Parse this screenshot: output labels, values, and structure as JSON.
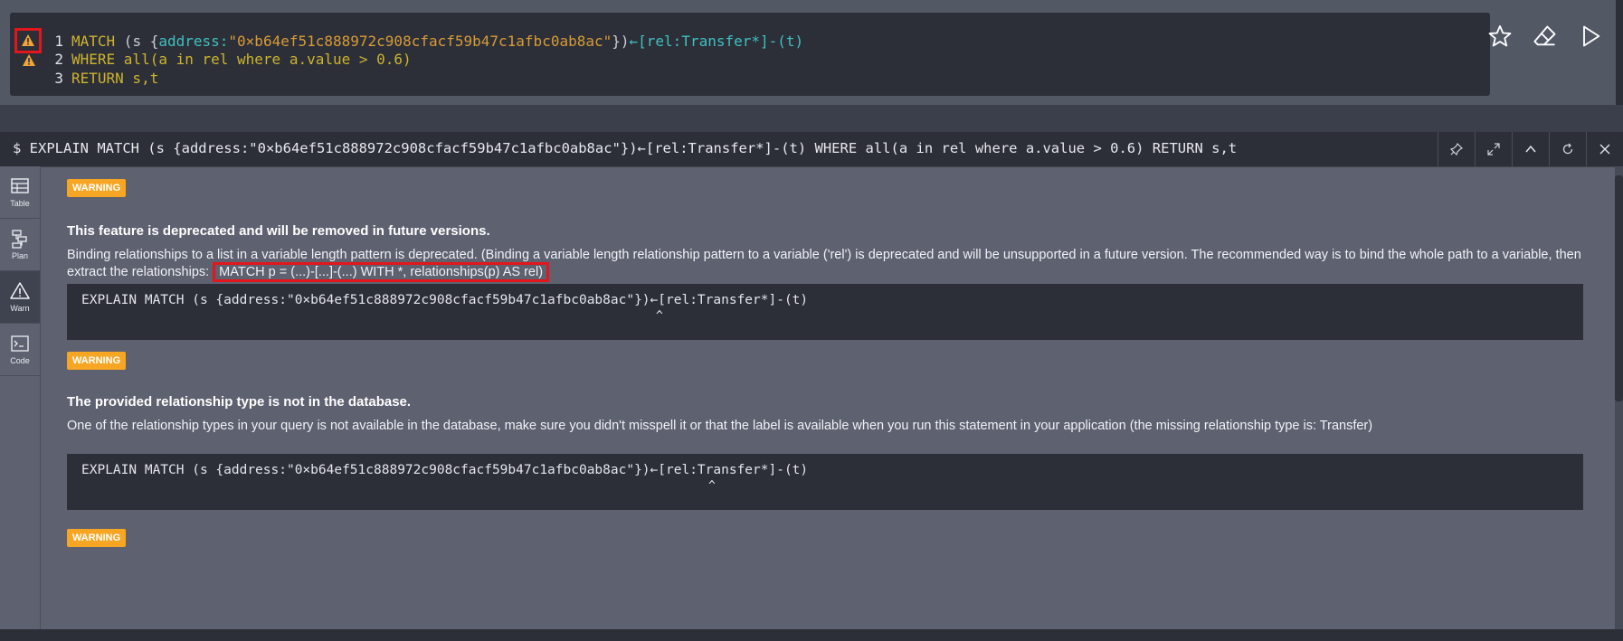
{
  "editor": {
    "lines": [
      {
        "num": "1",
        "warning": true,
        "seg_kw": "MATCH",
        "seg_open": " (s {",
        "seg_key": "address:",
        "seg_str": "\"0×b64ef51c888972c908cfacf59b47c1afbc0ab8ac\"",
        "seg_close": "})",
        "seg_arrow": "←[rel:Transfer*]-(t)"
      },
      {
        "num": "2",
        "warning": true,
        "text": "WHERE all(a in rel where a.value > 0.6)"
      },
      {
        "num": "3",
        "warning": false,
        "text": "RETURN s,t"
      }
    ],
    "actions": [
      "star-icon",
      "eraser-icon",
      "play-icon"
    ]
  },
  "frame": {
    "command": "$ EXPLAIN MATCH (s {address:\"0×b64ef51c888972c908cfacf59b47c1afbc0ab8ac\"})←[rel:Transfer*]-(t) WHERE all(a in rel where a.value > 0.6) RETURN s,t",
    "buttons": [
      "pin-icon",
      "expand-icon",
      "collapse-icon",
      "rerun-icon",
      "close-icon"
    ],
    "sidebar": [
      {
        "label": "Table",
        "icon": "table-icon"
      },
      {
        "label": "Plan",
        "icon": "plan-icon"
      },
      {
        "label": "Warn",
        "icon": "warning-icon"
      },
      {
        "label": "Code",
        "icon": "code-icon"
      }
    ],
    "warnings": [
      {
        "badge": "WARNING",
        "title": "This feature is deprecated and will be removed in future versions.",
        "desc": "Binding relationships to a list in a variable length pattern is deprecated. (Binding a variable length relationship pattern to a variable ('rel') is deprecated and will be unsupported in a future version. The recommended way is to bind the whole path to a variable, then extract the relationships:",
        "desc_highlight": "MATCH p = (...)-[...]-(...) WITH *, relationships(p) AS rel)",
        "code": "EXPLAIN MATCH (s {address:\"0×b64ef51c888972c908cfacf59b47c1afbc0ab8ac\"})←[rel:Transfer*]-(t)",
        "caret": "^"
      },
      {
        "badge": "WARNING",
        "title": "The provided relationship type is not in the database.",
        "desc": "One of the relationship types in your query is not available in the database, make sure you didn't misspell it or that the label is available when you run this statement in your application (the missing relationship type is: Transfer)",
        "code": "EXPLAIN MATCH (s {address:\"0×b64ef51c888972c908cfacf59b47c1afbc0ab8ac\"})←[rel:Transfer*]-(t)",
        "caret": "^"
      },
      {
        "badge": "WARNING"
      }
    ]
  },
  "colors": {
    "warning": "#f7a624",
    "highlight": "#e2161b",
    "keyword": "#cdb32e",
    "string": "#d89b37"
  }
}
